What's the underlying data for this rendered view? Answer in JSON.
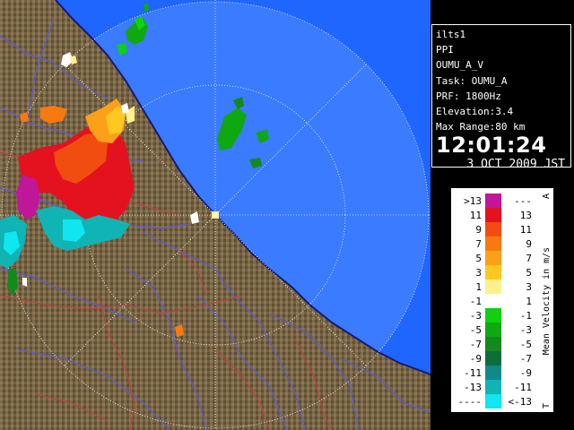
{
  "radar_info": {
    "site": "ilts1",
    "scan_type": "PPI",
    "product": "OUMU_A_V",
    "task": "Task: OUMU_A",
    "prf": "PRF: 1800Hz",
    "elevation": "Elevation:3.4",
    "max_range": "Max Range:80 km",
    "time": "12:01:24",
    "date": "3 OCT 2009 JST"
  },
  "legend": {
    "title": "Mean Velocity in m/s",
    "top_marker": "A",
    "bottom_marker": "T",
    "bins": [
      {
        "left": ">13",
        "right": "---",
        "color": "#c0169a"
      },
      {
        "left": "11",
        "right": "13",
        "color": "#e4121e"
      },
      {
        "left": "9",
        "right": "11",
        "color": "#f24d10"
      },
      {
        "left": "7",
        "right": "9",
        "color": "#f77a10"
      },
      {
        "left": "5",
        "right": "7",
        "color": "#fba018"
      },
      {
        "left": "3",
        "right": "5",
        "color": "#ffc820"
      },
      {
        "left": "1",
        "right": "3",
        "color": "#fff08c"
      },
      {
        "left": "-1",
        "right": "1",
        "color": "#ffffff"
      },
      {
        "left": "-3",
        "right": "-1",
        "color": "#10d010"
      },
      {
        "left": "-5",
        "right": "-3",
        "color": "#10a810"
      },
      {
        "left": "-7",
        "right": "-5",
        "color": "#128a1c"
      },
      {
        "left": "-9",
        "right": "-7",
        "color": "#0e6e3a"
      },
      {
        "left": "-11",
        "right": "-9",
        "color": "#0f8a8a"
      },
      {
        "left": "-13",
        "right": "-11",
        "color": "#10b4b4"
      },
      {
        "left": "----",
        "right": "<-13",
        "color": "#10e6f0"
      }
    ]
  },
  "colors": {
    "sea": "#1f66ff",
    "range_circle_fill": "#3a7bff",
    "land": "#7d6a4a",
    "rivers": "#5a5ad8",
    "boundaries": "#c04040",
    "range_rings": "#ffffff"
  },
  "map_features": {
    "radar_site_marker": "radar-site-icon",
    "range_rings_km": [
      40,
      80
    ]
  }
}
